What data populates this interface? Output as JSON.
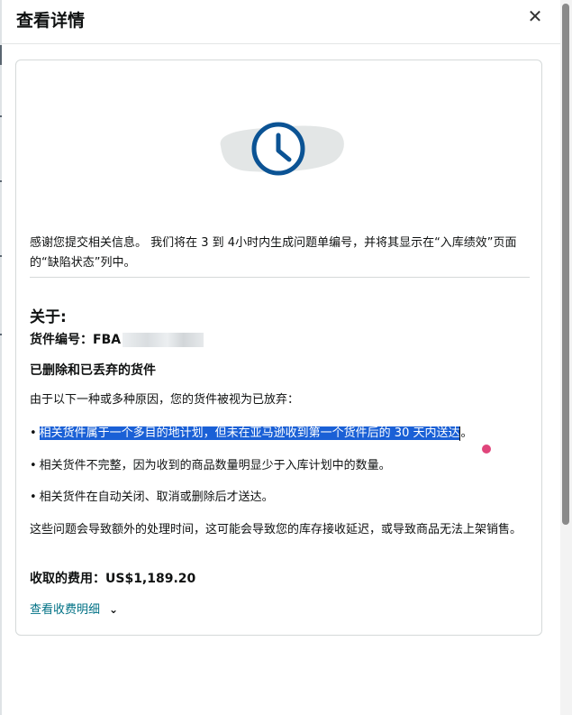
{
  "header": {
    "title": "查看详情",
    "close_icon": "close-icon"
  },
  "illustration": {
    "icon": "clock-icon",
    "color": "#0b5394",
    "blob_color": "#e3e6e6"
  },
  "message": "感谢您提交相关信息。 我们将在 3 到 4小时内生成问题单编号，并将其显示在“入库绩效”页面的“缺陷状态”列中。",
  "about": {
    "heading": "关于:",
    "shipment_label": "货件编号：FBA",
    "section_title": "已删除和已丢弃的货件",
    "reason_intro": "由于以下一种或多种原因，您的货件被视为已放弃：",
    "reasons": [
      "相关货件属于一个多目的地计划，但未在亚马逊收到第一个货件后的 30 天内送达",
      "相关货件不完整，因为收到的商品数量明显少于入库计划中的数量。",
      "相关货件在自动关闭、取消或删除后才送达。"
    ],
    "reason_1_suffix": "。",
    "bullet": "•",
    "impact": "这些问题会导致额外的处理时间，这可能会导致您的库存接收延迟，或导致商品无法上架销售。",
    "fee": "收取的费用：US$1,189.20",
    "fee_details_link": "查看收费明细",
    "fee_details_chevron": "chevron-down-icon"
  },
  "colors": {
    "selection": "#1a60d6",
    "link": "#007185",
    "handle": "#e0457b"
  }
}
